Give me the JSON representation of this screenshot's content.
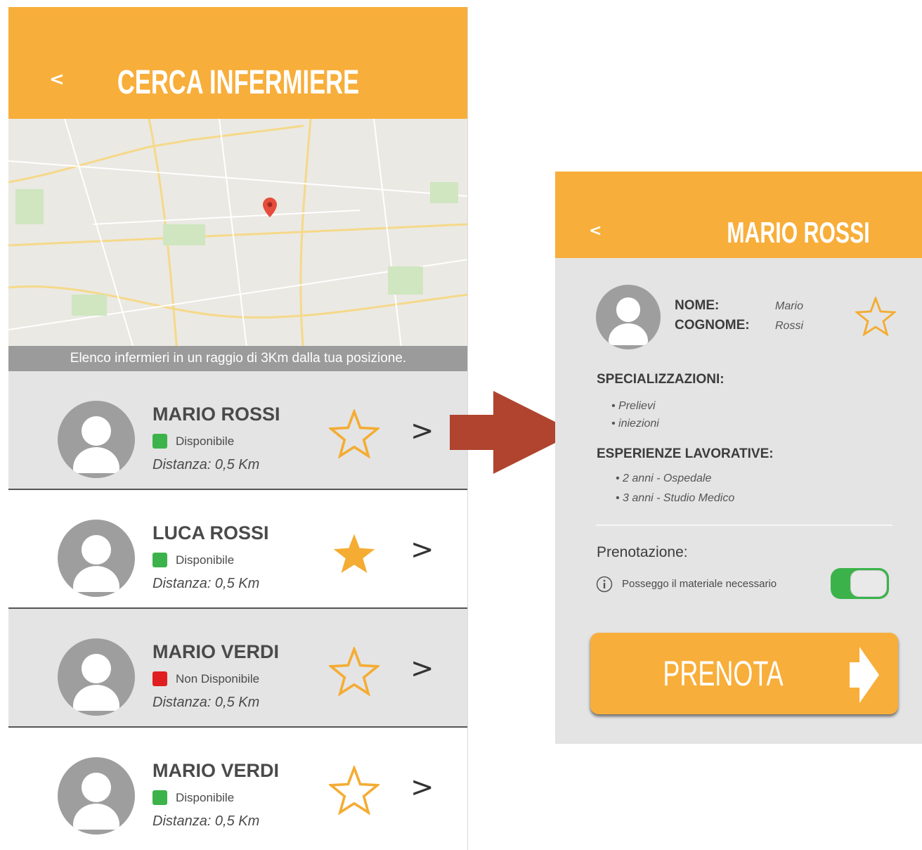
{
  "left": {
    "back_label": "<",
    "title": "CERCA INFERMIERE",
    "caption": "Elenco infermieri in un raggio di 3Km dalla tua posizione.",
    "nurses": [
      {
        "name": "MARIO ROSSI",
        "status": "Disponibile",
        "status_color": "#3bb34a",
        "distance": "Distanza: 0,5 Km",
        "favorite": false,
        "chevron": ">"
      },
      {
        "name": "LUCA ROSSI",
        "status": "Disponibile",
        "status_color": "#3bb34a",
        "distance": "Distanza: 0,5 Km",
        "favorite": true,
        "chevron": ">"
      },
      {
        "name": "MARIO VERDI",
        "status": "Non Disponibile",
        "status_color": "#e02020",
        "distance": "Distanza: 0,5 Km",
        "favorite": false,
        "chevron": ">"
      },
      {
        "name": "MARIO VERDI",
        "status": "Disponibile",
        "status_color": "#3bb34a",
        "distance": "Distanza: 0,5 Km",
        "favorite": false,
        "chevron": ">"
      }
    ]
  },
  "right": {
    "back_label": "<",
    "title": "MARIO ROSSI",
    "nome_label": "NOME:",
    "nome_value": "Mario",
    "cognome_label": "COGNOME:",
    "cognome_value": "Rossi",
    "spec_heading": "SPECIALIZZAZIONI:",
    "specializzazioni": [
      "• Prelievi",
      "• iniezioni"
    ],
    "exp_heading": "ESPERIENZE LAVORATIVE:",
    "esperienze": [
      "• 2 anni - Ospedale",
      "• 3 anni - Studio Medico"
    ],
    "prenotazione_label": "Prenotazione:",
    "material_label": "Posseggo il materiale necessario",
    "material_toggle_on": true,
    "prenota_label": "PRENOTA"
  },
  "colors": {
    "accent": "#f8ae3a",
    "available": "#3bb34a",
    "unavailable": "#e02020",
    "arrow": "#b0442e"
  },
  "icons": {
    "avatar": "user-avatar-icon",
    "star": "star-icon",
    "info": "info-icon",
    "next": "chevron-right-icon"
  }
}
